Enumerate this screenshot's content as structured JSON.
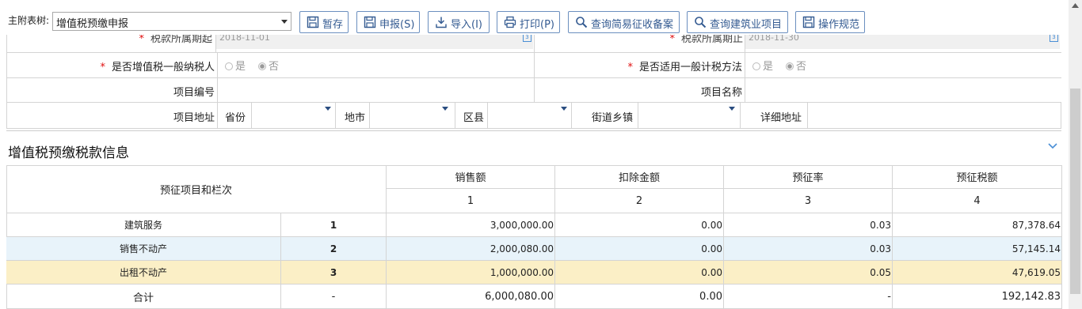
{
  "toolbar": {
    "form_label": "主附表树:",
    "form_select_value": "增值税预缴申报",
    "buttons": {
      "save": "暂存",
      "submit": "申报(S)",
      "import": "导入(I)",
      "print": "打印(P)",
      "query_simple": "查询简易征收备案",
      "query_construction": "查询建筑业项目",
      "guide": "操作规范"
    }
  },
  "form": {
    "period_start_label": "税款所属期起",
    "period_start_value": "2018-11-01",
    "period_end_label": "税款所属期止",
    "period_end_value": "2018-11-30",
    "general_taxpayer_label": "是否增值税一般纳税人",
    "general_method_label": "是否适用一般计税方法",
    "yes": "是",
    "no": "否",
    "project_no_label": "项目编号",
    "project_name_label": "项目名称",
    "project_addr_label": "项目地址",
    "province_label": "省份",
    "city_label": "地市",
    "district_label": "区县",
    "street_label": "街道乡镇",
    "detail_label": "详细地址"
  },
  "section": {
    "title": "增值税预缴税款信息"
  },
  "table": {
    "col_item_header": "预征项目和栏次",
    "headers": [
      "销售额",
      "扣除金额",
      "预征率",
      "预征税额"
    ],
    "header_numbers": [
      "1",
      "2",
      "3",
      "4"
    ],
    "rows": [
      {
        "name": "建筑服务",
        "no": "1",
        "sales": "3,000,000.00",
        "deduct": "0.00",
        "rate": "0.03",
        "tax": "87,378.64"
      },
      {
        "name": "销售不动产",
        "no": "2",
        "sales": "2,000,080.00",
        "deduct": "0.00",
        "rate": "0.03",
        "tax": "57,145.14"
      },
      {
        "name": "出租不动产",
        "no": "3",
        "sales": "1,000,000.00",
        "deduct": "0.00",
        "rate": "0.05",
        "tax": "47,619.05"
      }
    ],
    "total": {
      "name": "合计",
      "no": "-",
      "sales": "6,000,080.00",
      "deduct": "0.00",
      "rate": "-",
      "tax": "192,142.83"
    }
  },
  "colors": {
    "accent": "#335a91",
    "row_highlight_blue": "#e8f3fa",
    "row_highlight_yellow": "#fbefc6",
    "required": "#e01010"
  }
}
